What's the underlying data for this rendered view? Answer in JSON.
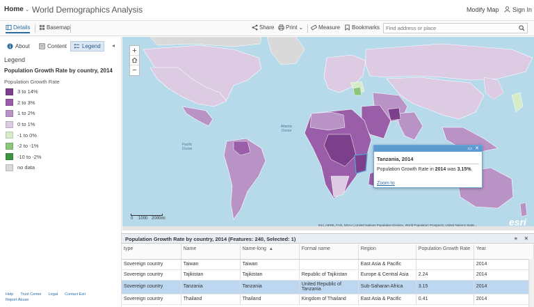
{
  "header": {
    "home_label": "Home",
    "home_chevron": "⌄",
    "app_title": "World Demographics Analysis",
    "modify_map": "Modify Map",
    "sign_in": "Sign In"
  },
  "toolbar": {
    "details": "Details",
    "basemap": "Basemap",
    "share": "Share",
    "print": "Print",
    "print_chevron": "⌄",
    "measure": "Measure",
    "bookmarks": "Bookmarks",
    "search_placeholder": "Find address or place"
  },
  "panel": {
    "tabs": [
      {
        "label": "About"
      },
      {
        "label": "Content"
      },
      {
        "label": "Legend"
      }
    ],
    "collapse": "◂",
    "legend_heading": "Legend",
    "layer_title": "Population Growth Rate by country, 2014",
    "field_name": "Population Growth Rate",
    "legend_items": [
      {
        "label": "3 to 14%",
        "color": "#7b3f8c"
      },
      {
        "label": "2 to 3%",
        "color": "#9a5ea8"
      },
      {
        "label": "1 to 2%",
        "color": "#b993c6"
      },
      {
        "label": "0 to 1%",
        "color": "#dccbe2"
      },
      {
        "label": "-1 to 0%",
        "color": "#d6ecc9"
      },
      {
        "label": "-2 to -1%",
        "color": "#8dc57a"
      },
      {
        "label": "-10 to -2%",
        "color": "#3f9442"
      },
      {
        "label": "no data",
        "color": "#d9d9d9"
      }
    ],
    "footer_links": [
      "Help",
      "Trust Center",
      "Legal",
      "Contact Esri",
      "Report Abuse"
    ]
  },
  "map": {
    "zoom_in": "+",
    "zoom_out": "−",
    "labels": {
      "pacific_n": "Pacific\nOcean",
      "atlantic": "Atlantic\nOcean",
      "pacific_s": "Pacific\nOcean",
      "indian": "Indian\nOcean"
    },
    "scale_labels": [
      "0",
      "1000",
      "2000mi"
    ],
    "attribution": "Esri, HERE, FAO, NOAA | United Nations Population Division, World Population Prospects; United Nations Statis...",
    "logo": "esri"
  },
  "popup": {
    "title": "Tanzania, 2014",
    "text_prefix": "Population Growth Rate in ",
    "year": "2014",
    "text_mid": " was ",
    "value": "3.15%",
    "text_end": ".",
    "zoom_to": "Zoom to"
  },
  "table": {
    "title": "Population Growth Rate by country, 2014 (Features: 240, Selected: 1)",
    "menu": "≡",
    "close": "✕",
    "sort_arrow": "▲",
    "columns": [
      "type",
      "Name",
      "Name-long",
      "Formal name",
      "Region",
      "Population Growth Rate",
      "Year"
    ],
    "rows": [
      {
        "type": "Sovereign country",
        "name": "Taiwan",
        "name_long": "Taiwan",
        "formal": "",
        "region": "East Asia & Pacific",
        "rate": "",
        "year": "2014"
      },
      {
        "type": "Sovereign country",
        "name": "Tajikistan",
        "name_long": "Tajikistan",
        "formal": "Republic of Tajikistan",
        "region": "Europe & Central Asia",
        "rate": "2.24",
        "year": "2014"
      },
      {
        "type": "Sovereign country",
        "name": "Tanzania",
        "name_long": "Tanzania",
        "formal": "United Republic of Tanzania",
        "region": "Sub-Saharan Africa",
        "rate": "3.15",
        "year": "2014"
      },
      {
        "type": "Sovereign country",
        "name": "Thailand",
        "name_long": "Thailand",
        "formal": "Kingdom of Thailand",
        "region": "East Asia & Pacific",
        "rate": "0.41",
        "year": "2014"
      }
    ]
  }
}
